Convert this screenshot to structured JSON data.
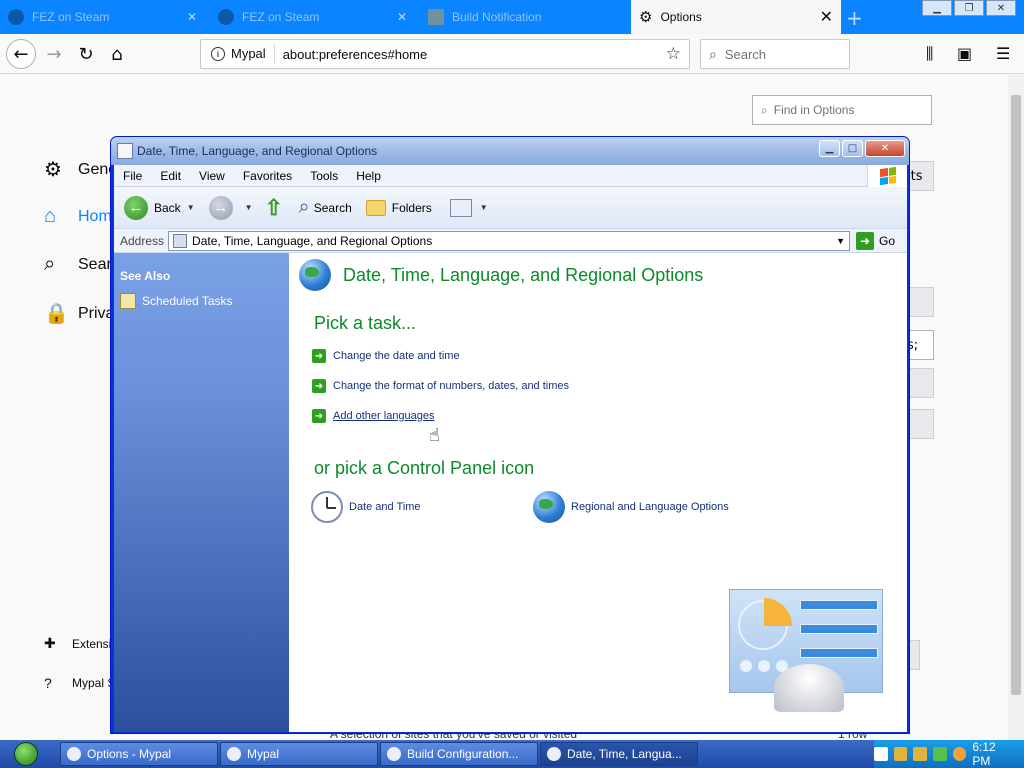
{
  "browser": {
    "tabs": [
      {
        "title": "FEZ on Steam",
        "state": "faded"
      },
      {
        "title": "FEZ on Steam",
        "state": "faded"
      },
      {
        "title": "Build Notification",
        "state": "faded"
      },
      {
        "title": "Options",
        "state": "active"
      }
    ],
    "identity": "Mypal",
    "url": "about:preferences#home",
    "search_placeholder": "Search"
  },
  "prefs": {
    "find_placeholder": "Find in Options",
    "categories": [
      {
        "label": "General",
        "icon": "gear-icon"
      },
      {
        "label": "Home",
        "icon": "home-icon"
      },
      {
        "label": "Search",
        "icon": "search-icon"
      },
      {
        "label": "Privacy & Security",
        "icon": "lock-icon"
      }
    ],
    "footer_links": [
      {
        "label": "Extensions & Themes",
        "icon": "puzzle-icon"
      },
      {
        "label": "Mypal Support",
        "icon": "help-icon"
      }
    ],
    "partial_right": {
      "defaults": "lts",
      "input_tail": "s;"
    },
    "bottom_text": "A selection of sites that you've saved or visited",
    "bottom_right": "1 row"
  },
  "xp": {
    "title": "Date, Time, Language, and Regional Options",
    "menu": [
      "File",
      "Edit",
      "View",
      "Favorites",
      "Tools",
      "Help"
    ],
    "toolbar": {
      "back": "Back",
      "search": "Search",
      "folders": "Folders"
    },
    "address_label": "Address",
    "address_value": "Date, Time, Language, and Regional Options",
    "go_label": "Go",
    "see_also": "See Also",
    "scheduled_tasks": "Scheduled Tasks",
    "header": "Date, Time, Language, and Regional Options",
    "pick_task": "Pick a task...",
    "tasks": [
      "Change the date and time",
      "Change the format of numbers, dates, and times",
      "Add other languages"
    ],
    "or_pick": "or pick a Control Panel icon",
    "icons": [
      {
        "label": "Date and Time",
        "icon": "clock-icon"
      },
      {
        "label": "Regional and Language Options",
        "icon": "globe-icon"
      }
    ]
  },
  "taskbar": {
    "buttons": [
      {
        "label": "Options - Mypal"
      },
      {
        "label": "Mypal"
      },
      {
        "label": "Build Configuration..."
      },
      {
        "label": "Date, Time, Langua..."
      }
    ],
    "clock": "6:12 PM"
  }
}
